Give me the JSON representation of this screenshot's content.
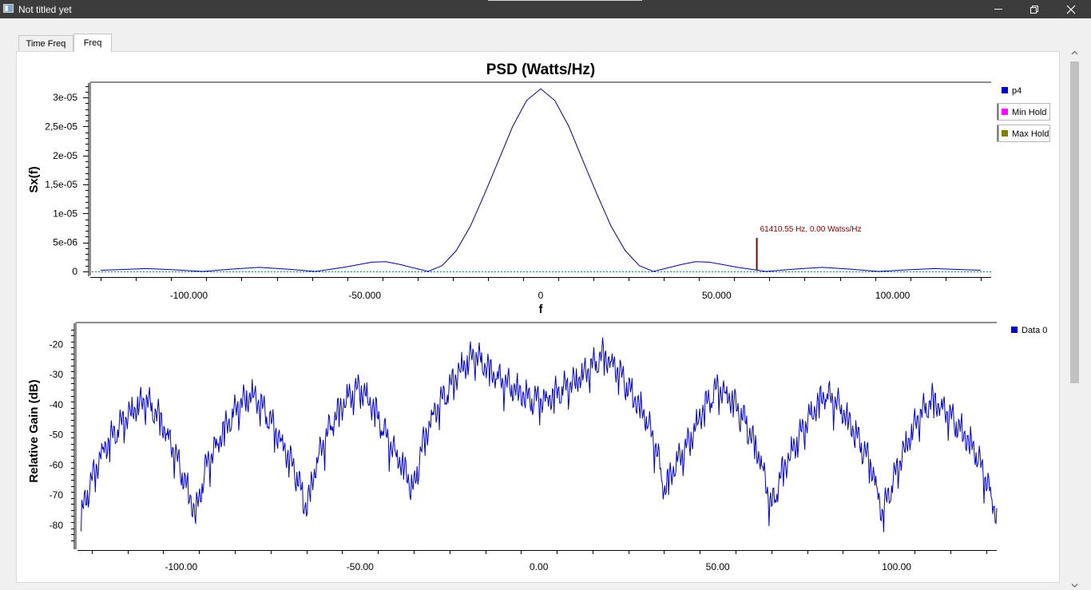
{
  "window": {
    "title": "Not titled yet"
  },
  "tabs": [
    {
      "label": "Time  Freq"
    },
    {
      "label": "Freq"
    }
  ],
  "colors": {
    "psd_trace": "#00008b",
    "p4": "#0000c8",
    "min_hold": "#ff00ff",
    "max_hold": "#808000",
    "gain_trace": "#0000c8",
    "marker": "#800000",
    "baseline": "#008080"
  },
  "marker": {
    "label": "61410.55 Hz, 0.00 Watss/Hz",
    "x": 61410.55,
    "y": 0.0
  },
  "chart_data": [
    {
      "type": "line",
      "title": "PSD (Watts/Hz)",
      "xlabel": "f",
      "ylabel": "Sx(f)",
      "xlim": [
        -128000,
        128000
      ],
      "ylim": [
        0,
        3.25e-05
      ],
      "x_tick_labels": [
        "-100.000",
        "-50.000",
        "0",
        "50.000",
        "100.000"
      ],
      "x_tick_values": [
        -100000,
        -50000,
        0,
        50000,
        100000
      ],
      "y_tick_labels": [
        "0",
        "5e-06",
        "1e-05",
        "1,5e-05",
        "2e-05",
        "2,5e-05",
        "3e-05"
      ],
      "y_tick_values": [
        0,
        5e-06,
        1e-05,
        1.5e-05,
        2e-05,
        2.5e-05,
        3e-05
      ],
      "legend": [
        "p4",
        "Min Hold",
        "Max Hold"
      ],
      "legend_position": "right",
      "series": [
        {
          "name": "p4",
          "x": [
            -125000,
            -120000,
            -112000,
            -105000,
            -96000,
            -88000,
            -80000,
            -72000,
            -64000,
            -56000,
            -48000,
            -44000,
            -40000,
            -32000,
            -28000,
            -24000,
            -20000,
            -16000,
            -12000,
            -8000,
            -4000,
            0,
            4000,
            8000,
            12000,
            16000,
            20000,
            24000,
            28000,
            32000,
            40000,
            44000,
            48000,
            56000,
            64000,
            72000,
            80000,
            88000,
            96000,
            105000,
            112000,
            120000,
            125000
          ],
          "y": [
            2e-07,
            3e-07,
            5e-07,
            3e-07,
            0,
            4e-07,
            7e-07,
            4e-07,
            0,
            7e-07,
            1.6e-06,
            1.7e-06,
            1.2e-06,
            0,
            1e-06,
            3.6e-06,
            7.8e-06,
            1.33e-05,
            1.91e-05,
            2.5e-05,
            2.95e-05,
            3.15e-05,
            2.95e-05,
            2.5e-05,
            1.91e-05,
            1.33e-05,
            7.8e-06,
            3.6e-06,
            1e-06,
            0,
            1.2e-06,
            1.7e-06,
            1.6e-06,
            7e-07,
            0,
            4e-07,
            7e-07,
            4e-07,
            0,
            3e-07,
            5e-07,
            3e-07,
            2e-07
          ]
        },
        {
          "name": "Min Hold",
          "x": [
            -125000,
            125000
          ],
          "y": [
            0,
            0
          ]
        },
        {
          "name": "Max Hold",
          "x": [
            -125000,
            125000
          ],
          "y": [
            0,
            0
          ]
        }
      ]
    },
    {
      "type": "line",
      "title": "",
      "xlabel": "",
      "ylabel": "Relative Gain (dB)",
      "xlim": [
        -129000,
        128000
      ],
      "ylim": [
        -88,
        -13
      ],
      "x_tick_labels": [
        "-100.00",
        "-50.00",
        "0.00",
        "50.00",
        "100.00"
      ],
      "x_tick_values": [
        -100000,
        -50000,
        0,
        50000,
        100000
      ],
      "y_tick_labels": [
        "-20",
        "-30",
        "-40",
        "-50",
        "-60",
        "-70",
        "-80"
      ],
      "y_tick_values": [
        -20,
        -30,
        -40,
        -50,
        -60,
        -70,
        -80
      ],
      "legend": [
        "Data 0"
      ],
      "legend_position": "top-right",
      "series": [
        {
          "name": "Data 0",
          "x": [
            -128000,
            -126000,
            -122000,
            -118000,
            -114000,
            -110000,
            -106000,
            -102000,
            -99000,
            -96000,
            -93000,
            -88000,
            -84000,
            -80000,
            -76000,
            -72000,
            -68000,
            -65000,
            -62000,
            -58000,
            -54000,
            -50000,
            -46000,
            -42000,
            -38000,
            -35000,
            -33000,
            -30000,
            -26000,
            -22000,
            -18000,
            -14000,
            -10000,
            -6000,
            -2000,
            2000,
            6000,
            10000,
            14000,
            18000,
            22000,
            26000,
            30000,
            33000,
            35000,
            38000,
            42000,
            46000,
            50000,
            54000,
            58000,
            62000,
            65000,
            68000,
            72000,
            76000,
            80000,
            84000,
            88000,
            93000,
            96000,
            99000,
            102000,
            106000,
            110000,
            114000,
            118000,
            122000,
            126000,
            128000
          ],
          "y": [
            -77,
            -68,
            -55,
            -48,
            -42,
            -38,
            -44,
            -55,
            -65,
            -76,
            -60,
            -48,
            -40,
            -36,
            -43,
            -52,
            -62,
            -74,
            -58,
            -46,
            -38,
            -34,
            -41,
            -52,
            -60,
            -68,
            -55,
            -44,
            -36,
            -28,
            -23,
            -28,
            -32,
            -35,
            -38,
            -38,
            -35,
            -32,
            -28,
            -23,
            -28,
            -36,
            -44,
            -55,
            -68,
            -60,
            -52,
            -41,
            -34,
            -38,
            -46,
            -58,
            -74,
            -62,
            -52,
            -43,
            -36,
            -40,
            -48,
            -60,
            -76,
            -65,
            -55,
            -44,
            -38,
            -42,
            -48,
            -55,
            -68,
            -77
          ]
        }
      ]
    }
  ]
}
